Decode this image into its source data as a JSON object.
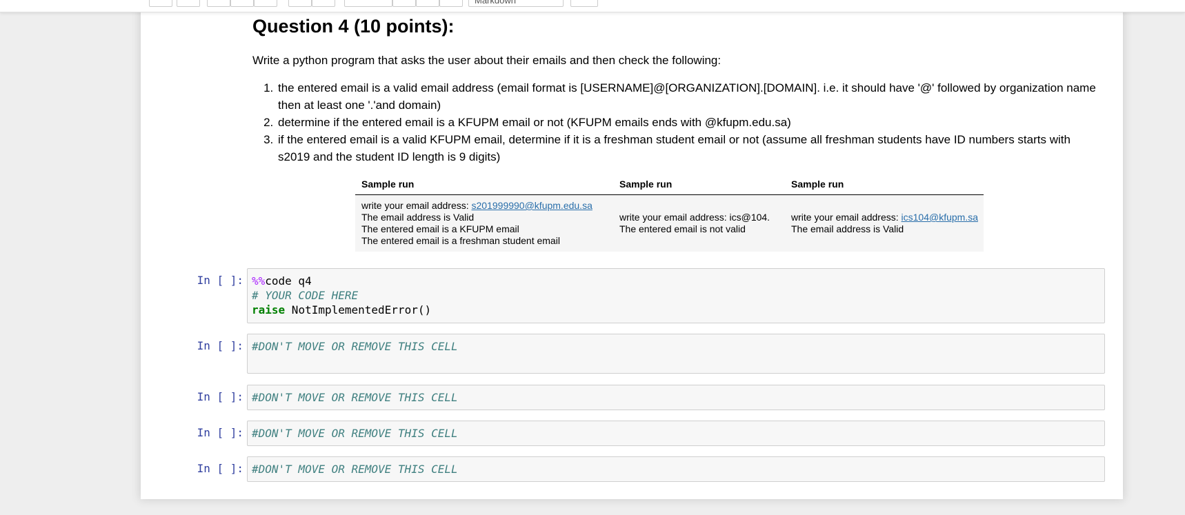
{
  "toolbar": {
    "cell_type_value": "Markdown"
  },
  "question": {
    "title": "Question 4 (10 points):",
    "intro": "Write a python program that asks the user about their emails and then check the following:",
    "items": [
      "the entered email is a valid email address (email format is [USERNAME]@[ORGANIZATION].[DOMAIN]. i.e. it should have '@' followed by organization name then at least one '.'and domain)",
      "determine if the entered email is a KFUPM email or not (KFUPM emails ends with @kfupm.edu.sa)",
      "if the entered email is a valid KFUPM email, determine if it is a freshman student email or not (assume all freshman students have ID numbers starts with s2019 and the student ID length is 9 digits)"
    ]
  },
  "sample_table": {
    "headers": [
      "Sample run",
      "Sample run",
      "Sample run"
    ],
    "col1": {
      "prompt": "write your email address: ",
      "email": "s201999990@kfupm.edu.sa",
      "line2": "The email address is Valid",
      "line3": "The entered email is a KFUPM email",
      "line4": "The entered email is a freshman student email"
    },
    "col2": {
      "line1": "write your email address: ics@104.",
      "line2": "The entered email is not valid"
    },
    "col3": {
      "prompt": "write your email address: ",
      "email": "ics104@kfupm.sa",
      "line2": "The email address is Valid"
    }
  },
  "cells": [
    {
      "prompt": "In [ ]:",
      "magic": "%%",
      "magic_rest": "code q4",
      "comment": "# YOUR CODE HERE",
      "keyword": "raise",
      "rest": " NotImplementedError()"
    },
    {
      "prompt": "In [ ]:",
      "comment": "#DON'T MOVE OR REMOVE THIS CELL"
    },
    {
      "prompt": "In [ ]:",
      "comment": "#DON'T MOVE OR REMOVE THIS CELL"
    },
    {
      "prompt": "In [ ]:",
      "comment": "#DON'T MOVE OR REMOVE THIS CELL"
    },
    {
      "prompt": "In [ ]:",
      "comment": "#DON'T MOVE OR REMOVE THIS CELL"
    }
  ]
}
